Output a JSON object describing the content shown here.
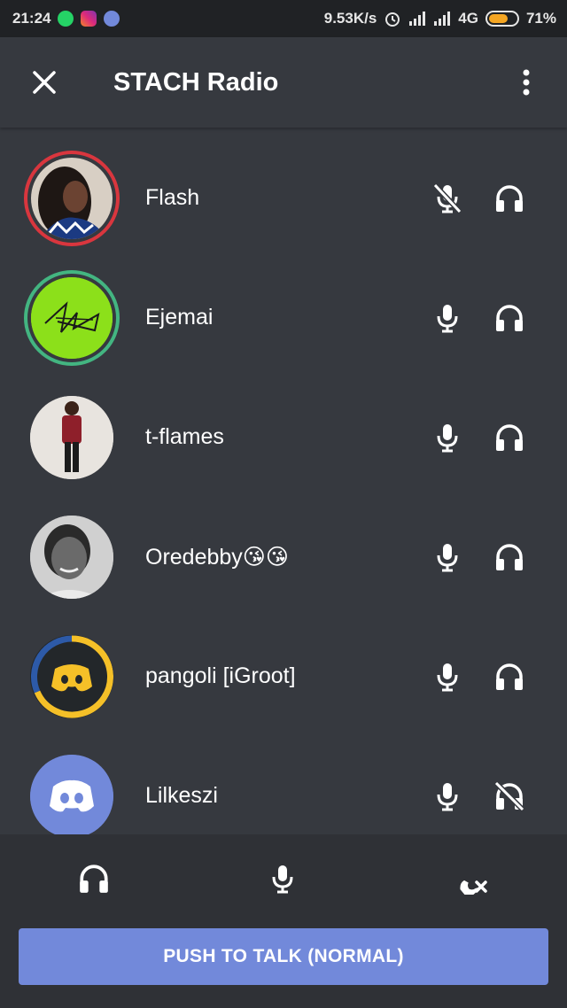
{
  "status_bar": {
    "time": "21:24",
    "network_speed": "9.53K/s",
    "network_type": "4G",
    "battery": "71%",
    "battery_level": 0.71
  },
  "header": {
    "title": "STACH Radio"
  },
  "members": [
    {
      "name": "Flash",
      "mic": "muted",
      "headphones": "on",
      "ring_color": "#d9363e",
      "avatar": "photo-woman"
    },
    {
      "name": "Ejemai",
      "mic": "on",
      "headphones": "on",
      "ring_color": "#43b581",
      "avatar": "signature-green"
    },
    {
      "name": "t-flames",
      "mic": "on",
      "headphones": "on",
      "ring_color": "",
      "avatar": "photo-man"
    },
    {
      "name": "Oredebby😘😘",
      "mic": "on",
      "headphones": "on",
      "ring_color": "",
      "avatar": "photo-grayscale"
    },
    {
      "name": "pangoli [iGroot]",
      "mic": "on",
      "headphones": "on",
      "ring_color": "",
      "avatar": "discord-yellow"
    },
    {
      "name": "Lilkeszi",
      "mic": "on",
      "headphones": "deafened",
      "ring_color": "",
      "avatar": "discord-default"
    }
  ],
  "controls": {
    "push_to_talk_label": "PUSH TO TALK (NORMAL)",
    "accent": "#7289da"
  },
  "icons": {
    "close": "close-icon",
    "more": "more-vertical-icon",
    "mic": "microphone-icon",
    "mic_muted": "microphone-muted-icon",
    "headphones": "headphones-icon",
    "headphones_deafened": "headphones-deafened-icon",
    "disconnect": "disconnect-call-icon"
  }
}
